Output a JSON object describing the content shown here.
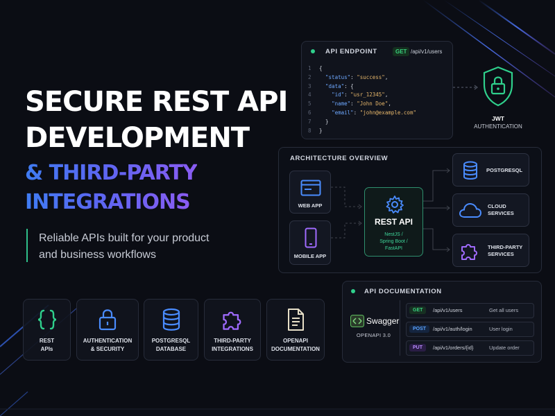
{
  "headline": {
    "line1": "SECURE REST API",
    "line2": "DEVELOPMENT",
    "line3": "& THIRD-PARTY",
    "line4": "INTEGRATIONS"
  },
  "subtitle": {
    "line1": "Reliable APIs built for your product",
    "line2": "and business workflows"
  },
  "api_endpoint": {
    "label": "API ENDPOINT",
    "method": "GET",
    "path": "/api/v1/users",
    "code": [
      {
        "n": "1",
        "text": "{"
      },
      {
        "n": "2",
        "key": "\"status\"",
        "val": "\"success\"",
        "indent": "  ",
        "end": ","
      },
      {
        "n": "3",
        "key": "\"data\"",
        "val": "{",
        "indent": "  ",
        "end": ""
      },
      {
        "n": "4",
        "key": "\"id\"",
        "val": "\"usr_12345\"",
        "indent": "    ",
        "end": ","
      },
      {
        "n": "5",
        "key": "\"name\"",
        "val": "\"John Doe\"",
        "indent": "    ",
        "end": ","
      },
      {
        "n": "6",
        "key": "\"email\"",
        "val": "\"john@example.com\"",
        "indent": "    ",
        "end": ""
      },
      {
        "n": "7",
        "text": "  }"
      },
      {
        "n": "8",
        "text": "}"
      }
    ]
  },
  "jwt": {
    "title": "JWT",
    "subtitle": "AUTHENTICATION"
  },
  "architecture": {
    "label": "ARCHITECTURE OVERVIEW",
    "web_app": "WEB APP",
    "mobile_app": "MOBILE APP",
    "rest_title": "REST API",
    "rest_sub1": "NestJS /",
    "rest_sub2": "Spring Boot /",
    "rest_sub3": "FastAPI",
    "postgres": "POSTGRESQL",
    "cloud1": "CLOUD",
    "cloud2": "SERVICES",
    "third1": "THIRD-PARTY",
    "third2": "SERVICES"
  },
  "features": [
    {
      "l1": "REST",
      "l2": "APIs",
      "icon": "braces-icon"
    },
    {
      "l1": "AUTHENTICATION",
      "l2": "& SECURITY",
      "icon": "lock-icon"
    },
    {
      "l1": "POSTGRESQL",
      "l2": "DATABASE",
      "icon": "database-icon"
    },
    {
      "l1": "THIRD-PARTY",
      "l2": "INTEGRATIONS",
      "icon": "puzzle-icon"
    },
    {
      "l1": "OPENAPI",
      "l2": "DOCUMENTATION",
      "icon": "document-icon"
    }
  ],
  "documentation": {
    "label": "API DOCUMENTATION",
    "swagger": "Swagger",
    "openapi": "OPENAPI 3.0",
    "rows": [
      {
        "method": "GET",
        "path": "/api/v1/users",
        "desc": "Get all users"
      },
      {
        "method": "POST",
        "path": "/api/v1/auth/login",
        "desc": "User login"
      },
      {
        "method": "PUT",
        "path": "/api/v1/orders/{id}",
        "desc": "Update order"
      }
    ]
  },
  "colors": {
    "accent_green": "#2fd08c",
    "accent_blue": "#3f7cf3",
    "accent_purple": "#8a5cf2",
    "background": "#0b0d14"
  }
}
